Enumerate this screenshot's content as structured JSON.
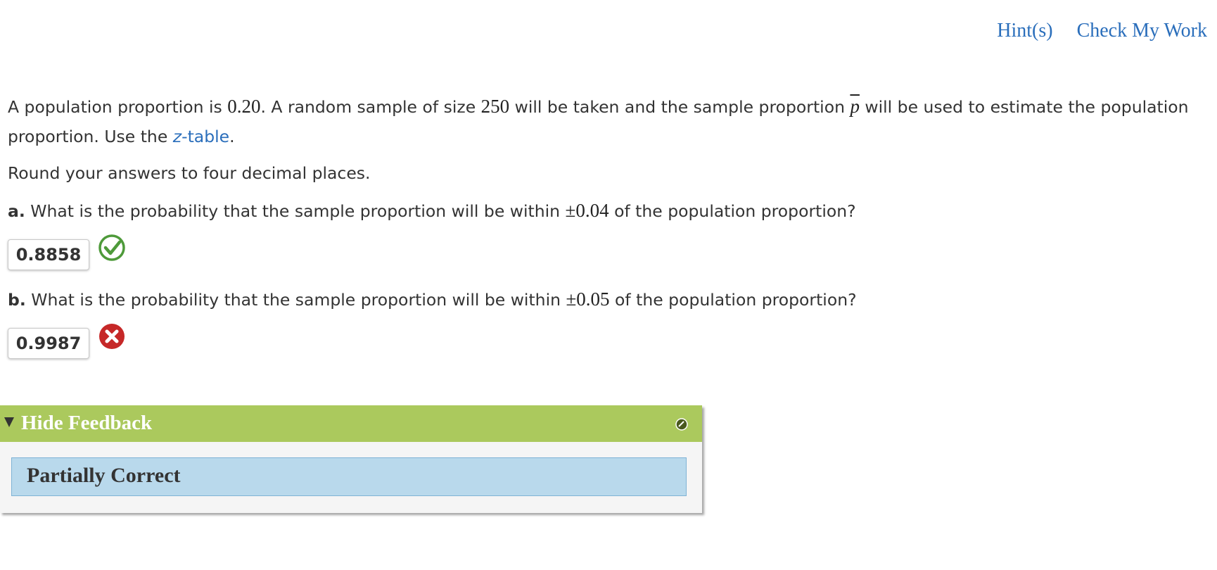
{
  "top_links": {
    "hints": "Hint(s)",
    "check_my_work": "Check My Work"
  },
  "problem": {
    "line1_pre": "A population proportion is ",
    "proportion": "0.20",
    "line1_mid": ". A random sample of size ",
    "sample_size": "250",
    "line1_mid2": " will be taken and the sample proportion ",
    "pbar_symbol": "p",
    "line1_post": " will be used to estimate the population proportion. Use the ",
    "ztable_z": "z",
    "ztable_rest": "-table",
    "line1_end": "."
  },
  "instruction": "Round your answers to four decimal places.",
  "question_a": {
    "label": "a.",
    "text_pre": " What is the probability that the sample proportion will be within ",
    "margin": "±0.04",
    "text_post": " of the population proportion?",
    "answer": "0.8858",
    "status_icon": "checkmark-icon",
    "status_color": "#4caf50"
  },
  "question_b": {
    "label": "b.",
    "text_pre": " What is the probability that the sample proportion will be within ",
    "margin": "±0.05",
    "text_post": " of the population proportion?",
    "answer": "0.9987",
    "status_icon": "x-icon",
    "status_color": "#c62828"
  },
  "feedback": {
    "toggle_label": "Hide Feedback",
    "status": "Partially Correct",
    "header_color": "#abc95d",
    "body_color": "#b9d9ec"
  }
}
